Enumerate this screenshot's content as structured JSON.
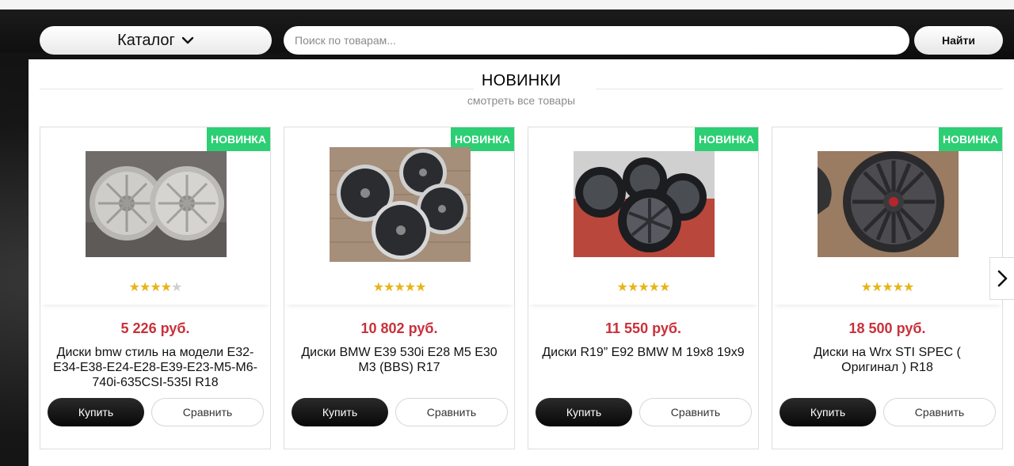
{
  "header": {
    "catalog_label": "Каталог",
    "search_placeholder": "Поиск по товарам...",
    "search_value": "",
    "find_label": "Найти"
  },
  "section": {
    "title": "НОВИНКИ",
    "link": "смотреть все товары"
  },
  "products": [
    {
      "badge": "НОВИНКА",
      "rating": 3.5,
      "stars": {
        "on": "★★★★",
        "off": "★"
      },
      "price": "5 226 руб.",
      "name": "Диски bmw стиль на модели E32-E34-E38-E24-E28-E39-E23-M5-M6-740i-635CSI-535I R18",
      "buy": "Купить",
      "compare": "Сравнить"
    },
    {
      "badge": "НОВИНКА",
      "rating": 5,
      "stars": {
        "on": "★★★★★",
        "off": ""
      },
      "price": "10 802 руб.",
      "name": "Диски BMW E39 530i E28 M5 E30 M3 (BBS) R17",
      "buy": "Купить",
      "compare": "Сравнить"
    },
    {
      "badge": "НОВИНКА",
      "rating": 5,
      "stars": {
        "on": "★★★★★",
        "off": ""
      },
      "price": "11 550 руб.",
      "name": "Диски R19” E92 BMW M 19x8 19x9",
      "buy": "Купить",
      "compare": "Сравнить"
    },
    {
      "badge": "НОВИНКА",
      "rating": 4.5,
      "stars": {
        "on": "★★★★★",
        "off": ""
      },
      "price": "18 500 руб.",
      "name": "Диски на Wrx STI SPEC ( Оригинал ) R18",
      "buy": "Купить",
      "compare": "Сравнить"
    }
  ],
  "icons": {
    "catalog": "chevron-down-icon",
    "carousel_next": "chevron-right-icon",
    "rating": "star-icon"
  },
  "colors": {
    "badge": "#2ccf73",
    "price": "#c9303a",
    "star": "#e8b41a",
    "buy_button": "#111111"
  }
}
